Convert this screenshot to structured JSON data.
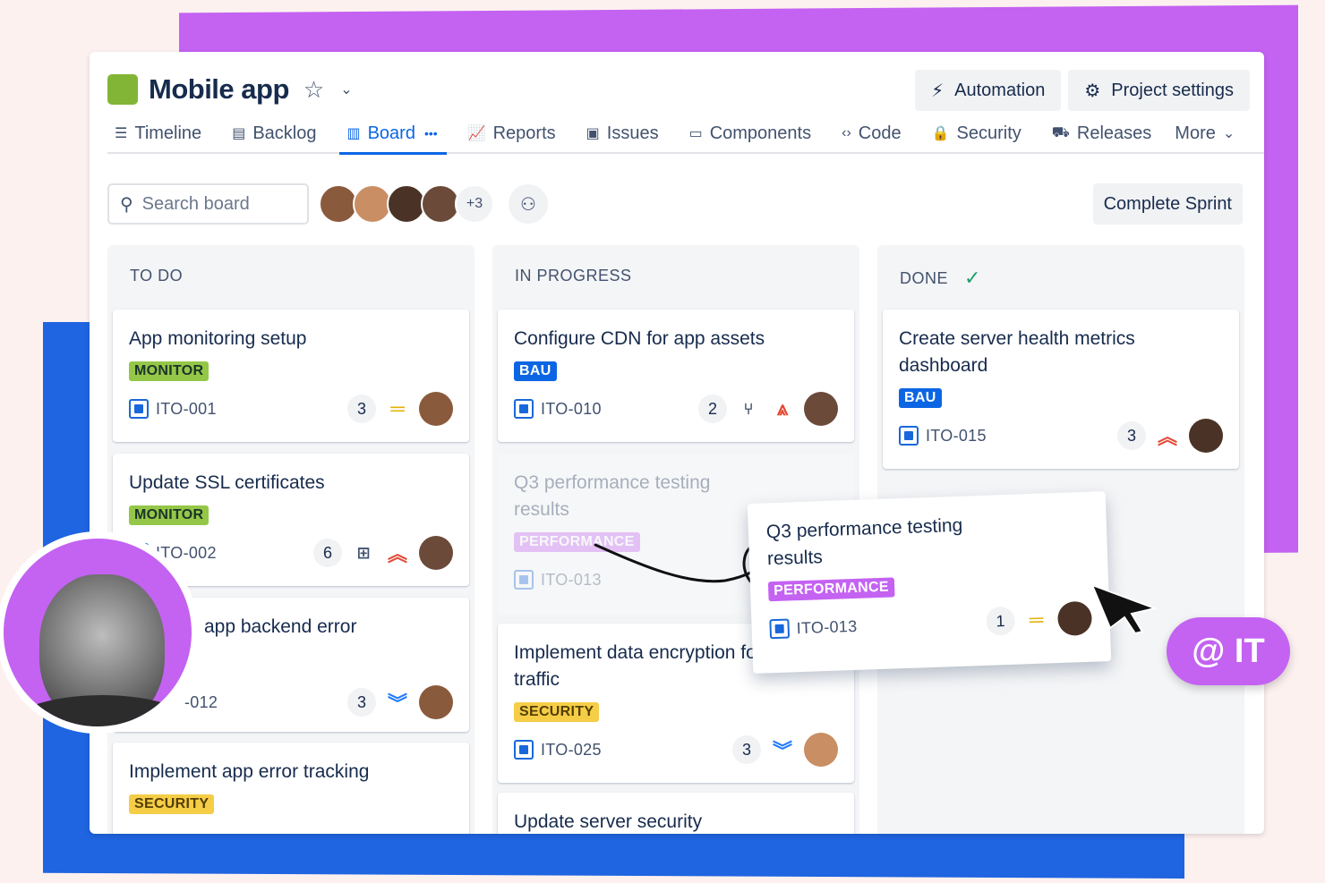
{
  "project": {
    "title": "Mobile app"
  },
  "header_buttons": {
    "automation": "Automation",
    "settings": "Project settings"
  },
  "nav": [
    {
      "label": "Timeline",
      "icon": "timeline-icon"
    },
    {
      "label": "Backlog",
      "icon": "backlog-icon"
    },
    {
      "label": "Board",
      "icon": "board-icon",
      "active": true
    },
    {
      "label": "Reports",
      "icon": "reports-icon"
    },
    {
      "label": "Issues",
      "icon": "issues-icon"
    },
    {
      "label": "Components",
      "icon": "components-icon"
    },
    {
      "label": "Code",
      "icon": "code-icon"
    },
    {
      "label": "Security",
      "icon": "lock-icon"
    },
    {
      "label": "Releases",
      "icon": "releases-icon"
    },
    {
      "label": "More",
      "icon": "chevron-down-icon"
    }
  ],
  "toolbar": {
    "search_placeholder": "Search board",
    "avatar_more": "+3",
    "complete_sprint": "Complete Sprint"
  },
  "columns": {
    "todo": {
      "title": "TO DO",
      "cards": [
        {
          "title": "App monitoring setup",
          "tag": "MONITOR",
          "key": "ITO-001",
          "points": "3",
          "priority": "medium"
        },
        {
          "title": "Update SSL certificates",
          "tag": "MONITOR",
          "key": "ITO-002",
          "points": "6",
          "priority": "high"
        },
        {
          "title": "app backend error",
          "key": "-012",
          "points": "3",
          "priority": "low"
        },
        {
          "title": "Implement app error tracking",
          "tag": "SECURITY"
        }
      ]
    },
    "inprogress": {
      "title": "IN PROGRESS",
      "cards": [
        {
          "title": "Configure CDN for app assets",
          "tag": "BAU",
          "key": "ITO-010",
          "points": "2",
          "priority": "highest"
        },
        {
          "title": "Q3 performance testing results",
          "tag": "PERFORMANCE",
          "key": "ITO-013"
        },
        {
          "title": "Implement data encryption for app traffic",
          "tag": "SECURITY",
          "key": "ITO-025",
          "points": "3",
          "priority": "low"
        },
        {
          "title": "Update server security"
        }
      ]
    },
    "done": {
      "title": "DONE",
      "cards": [
        {
          "title": "Create server health metrics dashboard",
          "tag": "BAU",
          "key": "ITO-015",
          "points": "3",
          "priority": "high"
        }
      ]
    }
  },
  "drag_card": {
    "title": "Q3 performance testing results",
    "tag": "PERFORMANCE",
    "key": "ITO-013",
    "points": "1",
    "priority": "medium"
  },
  "badge": {
    "text": "@ IT"
  },
  "colors": {
    "purple": "#c462f2",
    "blue": "#1f64e0",
    "green_logo": "#82b536",
    "link_blue": "#0c66e4"
  }
}
